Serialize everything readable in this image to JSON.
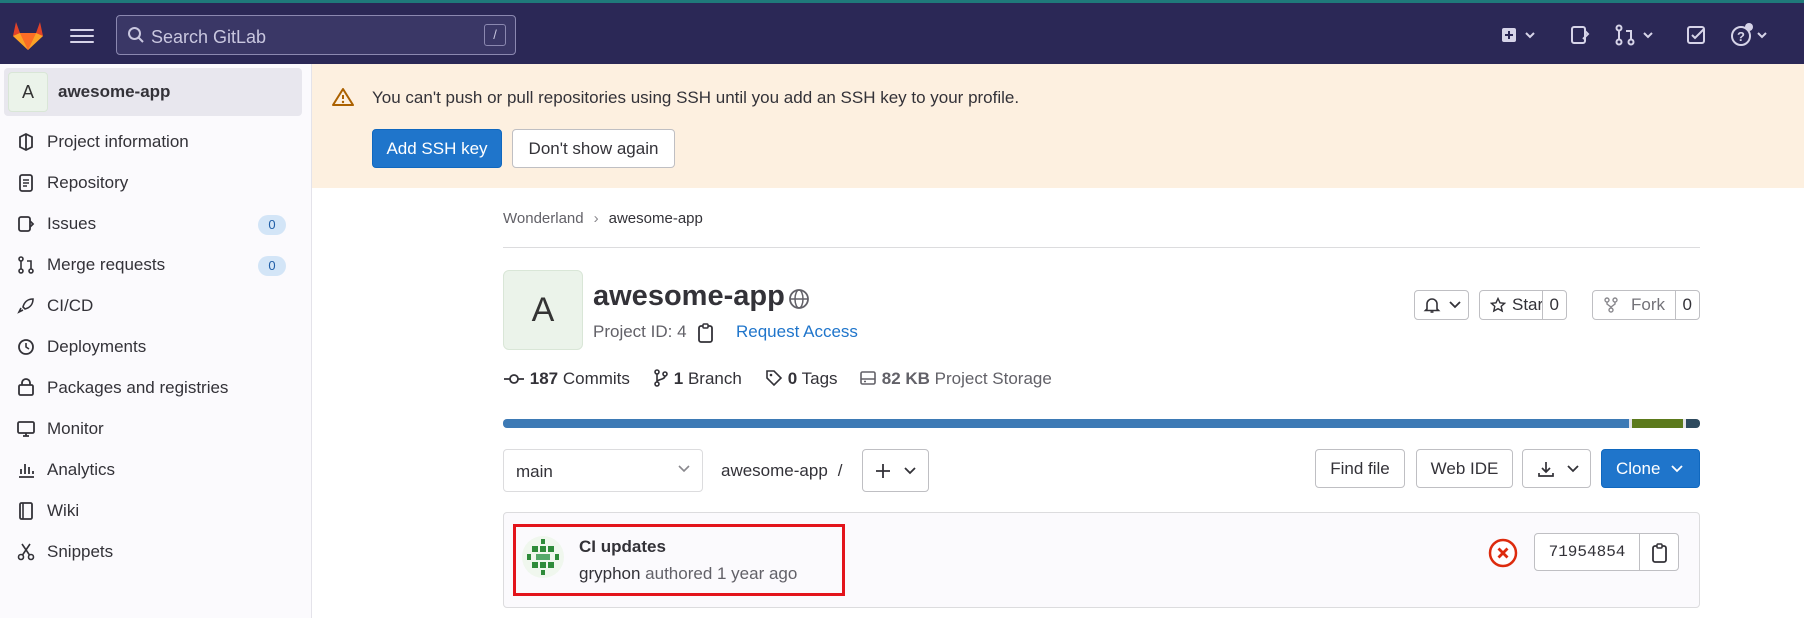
{
  "search": {
    "placeholder": "Search GitLab",
    "shortcut": "/"
  },
  "sidebar": {
    "project_initial": "A",
    "project_name": "awesome-app",
    "items": [
      {
        "label": "Project information",
        "icon": "project-icon"
      },
      {
        "label": "Repository",
        "icon": "document-icon"
      },
      {
        "label": "Issues",
        "icon": "issues-icon",
        "count": "0"
      },
      {
        "label": "Merge requests",
        "icon": "merge-request-icon",
        "count": "0"
      },
      {
        "label": "CI/CD",
        "icon": "rocket-icon"
      },
      {
        "label": "Deployments",
        "icon": "deployments-icon"
      },
      {
        "label": "Packages and registries",
        "icon": "package-icon"
      },
      {
        "label": "Monitor",
        "icon": "monitor-icon"
      },
      {
        "label": "Analytics",
        "icon": "chart-icon"
      },
      {
        "label": "Wiki",
        "icon": "book-icon"
      },
      {
        "label": "Snippets",
        "icon": "scissors-icon"
      }
    ]
  },
  "alert": {
    "message": "You can't push or pull repositories using SSH until you add an SSH key to your profile.",
    "primary_label": "Add SSH key",
    "secondary_label": "Don't show again"
  },
  "breadcrumb": {
    "group": "Wonderland",
    "project": "awesome-app"
  },
  "project": {
    "initial": "A",
    "title": "awesome-app",
    "id_text": "Project ID: 4",
    "request_access": "Request Access",
    "star_label": "Star",
    "star_count": "0",
    "fork_label": "Fork",
    "fork_count": "0"
  },
  "stats": {
    "commits_count": "187",
    "commits_label": "Commits",
    "branch_count": "1",
    "branch_label": "Branch",
    "tags_count": "0",
    "tags_label": "Tags",
    "storage_size": "82 KB",
    "storage_label": "Project Storage"
  },
  "language_bar": {
    "segments": [
      {
        "color": "#3d7ab5",
        "fraction": 0.943
      },
      {
        "color": "#5c7a1c",
        "fraction": 0.045
      },
      {
        "color": "#2e4a5e",
        "fraction": 0.012
      }
    ]
  },
  "repo_toolbar": {
    "branch": "main",
    "path": "awesome-app",
    "path_sep": "/",
    "find_file": "Find file",
    "web_ide": "Web IDE",
    "clone": "Clone"
  },
  "last_commit": {
    "title": "CI updates",
    "author": "gryphon",
    "meta": "authored 1 year ago",
    "sha": "71954854",
    "status": "failed",
    "status_color": "#dd2b0e"
  },
  "colors": {
    "navbar": "#2b2856",
    "accent": "#1f75cb",
    "alert_bg": "#fdf0e0"
  }
}
